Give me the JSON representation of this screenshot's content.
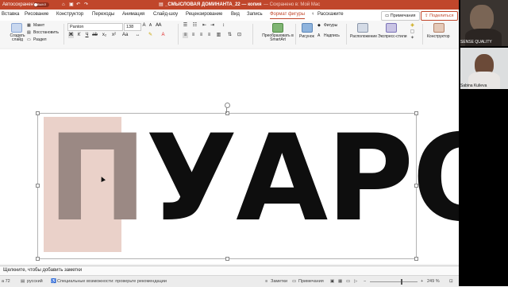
{
  "titlebar": {
    "autosave_label": "Автосохранение",
    "autosave_state": "ВЫКЛ",
    "document_title": "_СМЫСЛОВАЯ ДОМИНАНТА_22 — копия",
    "save_status": "— Сохранено в: Мой Mac"
  },
  "tabs": [
    "Вставка",
    "Рисование",
    "Конструктор",
    "Переходы",
    "Анимация",
    "Слайд-шоу",
    "Рецензирование",
    "Вид",
    "Запись",
    "Формат фигуры"
  ],
  "tell_me": "Расскажите",
  "comments_button": "Примечания",
  "share_button": "Поделиться",
  "ribbon": {
    "create_slide": "Создать слайд",
    "layout": "Макет",
    "reset": "Восстановить",
    "section": "Раздел",
    "font_name": "Panton",
    "font_size": "138",
    "convert_smartart": "Преобразовать в SmartArt",
    "picture": "Рисунок",
    "textbox": "Надпись",
    "shapes": "Фигуры",
    "arrange": "Расположение",
    "quick_styles": "Экспресс-стили",
    "designer": "Конструктор"
  },
  "slide": {
    "first_letter": "П",
    "rest_text": "УАРО"
  },
  "notes_placeholder": "Щелкните, чтобы добавить заметки",
  "status": {
    "slide_info": "а 72",
    "language": "русский",
    "accessibility": "Специальные возможности: проверьте рекомендации",
    "notes": "Заметки",
    "comments": "Примечания",
    "zoom": "249 %"
  },
  "video": {
    "participant_1": "SENSE QUALITY",
    "participant_2": "Sabina Kulieva"
  }
}
